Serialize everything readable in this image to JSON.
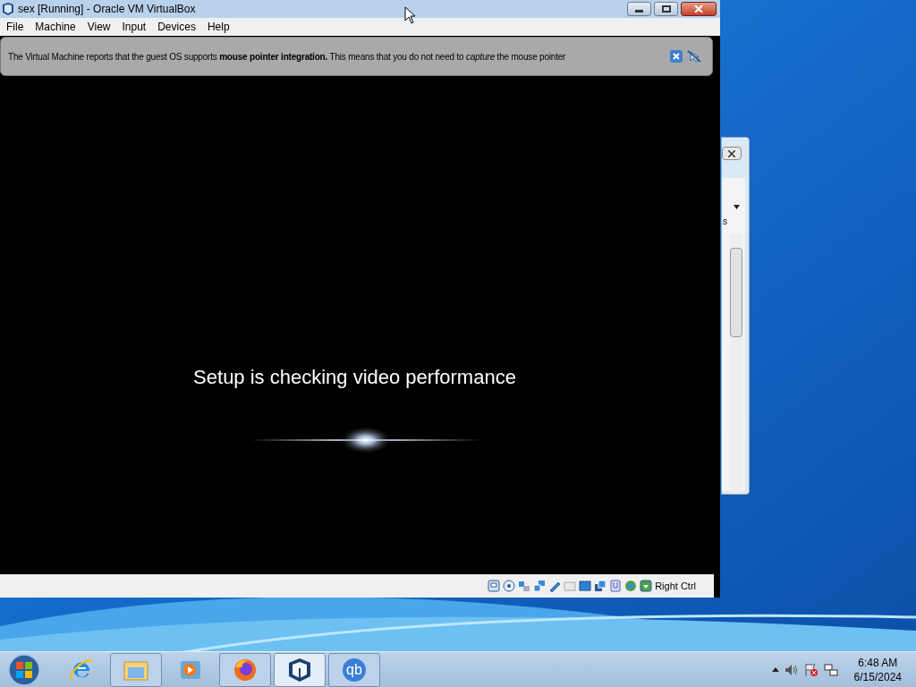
{
  "window": {
    "title": "sex [Running] - Oracle VM VirtualBox"
  },
  "menu": [
    "File",
    "Machine",
    "View",
    "Input",
    "Devices",
    "Help"
  ],
  "notice": {
    "text": "The Virtual Machine reports that the guest OS supports **mouse pointer integration.** This means that you do not need to *capture* the mouse pointer"
  },
  "guest_screen": {
    "message": "Setup is checking video performance"
  },
  "status_bar": {
    "host_key": "Right Ctrl"
  },
  "background_window": {
    "text": "s"
  },
  "taskbar": {
    "apps": [
      {
        "kind": "ie",
        "running": false,
        "selected": false
      },
      {
        "kind": "explorer",
        "running": true,
        "selected": false
      },
      {
        "kind": "media",
        "running": false,
        "selected": false
      },
      {
        "kind": "firefox",
        "running": true,
        "selected": false
      },
      {
        "kind": "virtualbox",
        "running": true,
        "selected": true
      },
      {
        "kind": "qbittorrent",
        "running": true,
        "selected": false,
        "label": "qb"
      }
    ],
    "clock": {
      "time": "6:48 AM",
      "date": "6/15/2024"
    }
  }
}
